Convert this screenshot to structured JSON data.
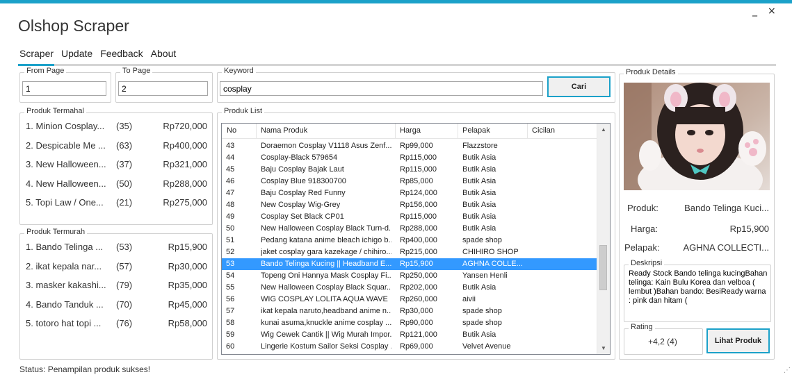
{
  "app": {
    "title": "Olshop Scraper"
  },
  "window": {
    "minimize": "_",
    "close": "×"
  },
  "menu": [
    "Scraper",
    "Update",
    "Feedback",
    "About"
  ],
  "from_page": {
    "label": "From Page",
    "value": "1"
  },
  "to_page": {
    "label": "To Page",
    "value": "2"
  },
  "keyword": {
    "label": "Keyword",
    "value": "cosplay",
    "button": "Cari"
  },
  "termahal": {
    "title": "Produk Termahal",
    "items": [
      {
        "name": "1.  Minion Cosplay...",
        "count": "(35)",
        "price": "Rp720,000"
      },
      {
        "name": "2.  Despicable Me ...",
        "count": "(63)",
        "price": "Rp400,000"
      },
      {
        "name": "3.  New Halloween...",
        "count": "(37)",
        "price": "Rp321,000"
      },
      {
        "name": "4.  New Halloween...",
        "count": "(50)",
        "price": "Rp288,000"
      },
      {
        "name": "5.  Topi Law / One...",
        "count": "(21)",
        "price": "Rp275,000"
      }
    ]
  },
  "termurah": {
    "title": "Produk Termurah",
    "items": [
      {
        "name": "1.  Bando Telinga ...",
        "count": "(53)",
        "price": "Rp15,900"
      },
      {
        "name": "2.  ikat kepala nar...",
        "count": "(57)",
        "price": "Rp30,000"
      },
      {
        "name": "3.  masker kakashi...",
        "count": "(79)",
        "price": "Rp35,000"
      },
      {
        "name": "4.  Bando Tanduk ...",
        "count": "(70)",
        "price": "Rp45,000"
      },
      {
        "name": "5.  totoro hat topi ...",
        "count": "(76)",
        "price": "Rp58,000"
      }
    ]
  },
  "produk_list": {
    "title": "Produk List",
    "columns": [
      "No",
      "Nama Produk",
      "Harga",
      "Pelapak",
      "Cicilan"
    ],
    "rows": [
      {
        "no": "43",
        "nama": "Doraemon Cosplay V1118 Asus Zenf...",
        "harga": "Rp99,000",
        "pelapak": "Flazzstore"
      },
      {
        "no": "44",
        "nama": "Cosplay-Black 579654",
        "harga": "Rp115,000",
        "pelapak": "Butik Asia"
      },
      {
        "no": "45",
        "nama": "Baju Cosplay Bajak Laut",
        "harga": "Rp115,000",
        "pelapak": "Butik Asia"
      },
      {
        "no": "46",
        "nama": "Cosplay Blue 918300700",
        "harga": "Rp85,000",
        "pelapak": "Butik Asia"
      },
      {
        "no": "47",
        "nama": "Baju Cosplay Red Funny",
        "harga": "Rp124,000",
        "pelapak": "Butik Asia"
      },
      {
        "no": "48",
        "nama": "New Cosplay Wig-Grey",
        "harga": "Rp156,000",
        "pelapak": "Butik Asia"
      },
      {
        "no": "49",
        "nama": "Cosplay Set Black CP01",
        "harga": "Rp115,000",
        "pelapak": "Butik Asia"
      },
      {
        "no": "50",
        "nama": "New Halloween Cosplay Black Turn-d...",
        "harga": "Rp288,000",
        "pelapak": "Butik Asia"
      },
      {
        "no": "51",
        "nama": "Pedang katana anime bleach ichigo b...",
        "harga": "Rp400,000",
        "pelapak": "spade shop"
      },
      {
        "no": "52",
        "nama": "jaket cosplay gara kazekage / chihiro...",
        "harga": "Rp215,000",
        "pelapak": "CHIHIRO SHOP"
      },
      {
        "no": "53",
        "nama": "Bando Telinga Kucing || Headband E...",
        "harga": "Rp15,900",
        "pelapak": "AGHNA COLLE...",
        "selected": true
      },
      {
        "no": "54",
        "nama": "Topeng Oni Hannya Mask Cosplay Fi...",
        "harga": "Rp250,000",
        "pelapak": "Yansen Henli"
      },
      {
        "no": "55",
        "nama": "New Halloween Cosplay Black Squar...",
        "harga": "Rp202,000",
        "pelapak": "Butik Asia"
      },
      {
        "no": "56",
        "nama": "WIG COSPLAY LOLITA AQUA WAVE",
        "harga": "Rp260,000",
        "pelapak": "aivii"
      },
      {
        "no": "57",
        "nama": "ikat kepala naruto,headband anime n...",
        "harga": "Rp30,000",
        "pelapak": "spade shop"
      },
      {
        "no": "58",
        "nama": "kunai asuma,knuckle anime cosplay ...",
        "harga": "Rp90,000",
        "pelapak": "spade shop"
      },
      {
        "no": "59",
        "nama": "Wig Cewek Cantik || Wig Murah Impor...",
        "harga": "Rp121,000",
        "pelapak": "Butik Asia"
      },
      {
        "no": "60",
        "nama": "Lingerie Kostum Sailor Seksi Cosplay ...",
        "harga": "Rp69,000",
        "pelapak": "Velvet Avenue"
      }
    ]
  },
  "details": {
    "title": "Produk Details",
    "produk_label": "Produk:",
    "produk_value": "Bando Telinga Kuci...",
    "harga_label": "Harga:",
    "harga_value": "Rp15,900",
    "pelapak_label": "Pelapak:",
    "pelapak_value": "AGHNA COLLECTI...",
    "deskripsi_title": "Deskripsi",
    "deskripsi": "Ready Stock Bando telinga kucingBahan telinga: Kain Bulu Korea dan velboa ( lembut )Bahan bando: BesiReady warna : pink dan hitam (",
    "rating_title": "Rating",
    "rating_value": "+4,2 (4)",
    "lihat_button": "Lihat Produk"
  },
  "status": "Status: Penampilan produk sukses!",
  "colors": {
    "accent": "#1ba1c9",
    "selection": "#3399ff"
  }
}
